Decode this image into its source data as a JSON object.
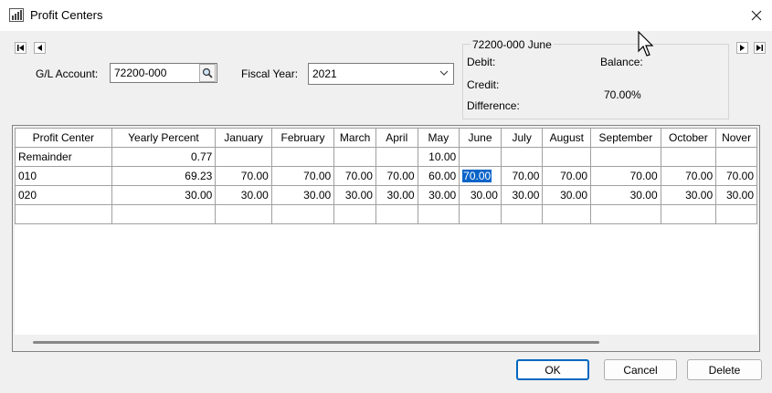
{
  "window": {
    "title": "Profit Centers",
    "icon": "bar-chart-icon",
    "close_icon": "close-icon"
  },
  "nav": {
    "first_icon": "first-record-icon",
    "prev_icon": "prev-record-icon",
    "next_icon": "next-record-icon",
    "last_icon": "last-record-icon"
  },
  "form": {
    "gl_account_label": "G/L Account:",
    "gl_account_value": "72200-000",
    "fiscal_year_label": "Fiscal Year:",
    "fiscal_year_value": "2021"
  },
  "summary": {
    "title": "72200-000 June",
    "debit_label": "Debit:",
    "balance_label": "Balance:",
    "credit_label": "Credit:",
    "difference_label": "Difference:",
    "percent_value": "70.00%"
  },
  "grid": {
    "columns": [
      "Profit Center",
      "Yearly Percent",
      "January",
      "February",
      "March",
      "April",
      "May",
      "June",
      "July",
      "August",
      "September",
      "October",
      "Nover"
    ],
    "rows": [
      [
        "Remainder",
        "0.77",
        "",
        "",
        "",
        "",
        "10.00",
        "",
        "",
        "",
        "",
        "",
        ""
      ],
      [
        "010",
        "69.23",
        "70.00",
        "70.00",
        "70.00",
        "70.00",
        "60.00",
        "70.00",
        "70.00",
        "70.00",
        "70.00",
        "70.00",
        "70.00"
      ],
      [
        "020",
        "30.00",
        "30.00",
        "30.00",
        "30.00",
        "30.00",
        "30.00",
        "30.00",
        "30.00",
        "30.00",
        "30.00",
        "30.00",
        "30.00"
      ],
      [
        "",
        "",
        "",
        "",
        "",
        "",
        "",
        "",
        "",
        "",
        "",
        "",
        ""
      ]
    ],
    "selected_row": 1,
    "selected_col": 7
  },
  "buttons": {
    "ok": "OK",
    "cancel": "Cancel",
    "delete": "Delete"
  }
}
